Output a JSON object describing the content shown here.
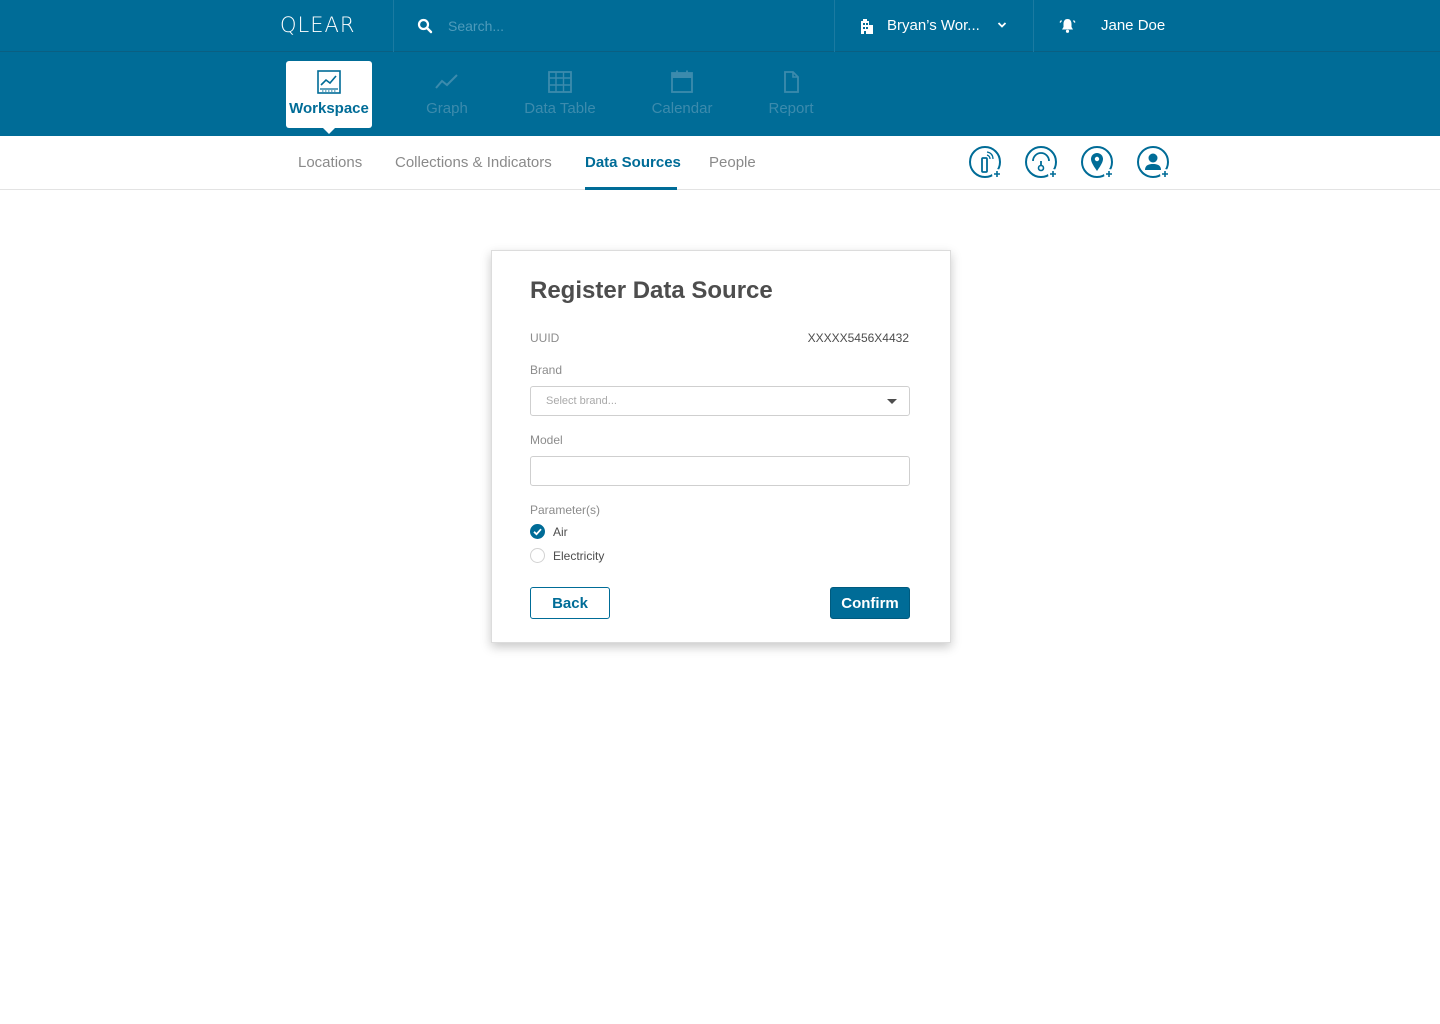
{
  "app": {
    "logo": "QLEAR"
  },
  "topbar": {
    "search_placeholder": "Search...",
    "workspace_label": "Bryan’s Wor...",
    "user_name": "Jane Doe"
  },
  "modules": [
    {
      "label": "Workspace",
      "icon": "workspace-chart-icon",
      "active": true
    },
    {
      "label": "Graph",
      "icon": "line-graph-icon",
      "active": false
    },
    {
      "label": "Data Table",
      "icon": "table-grid-icon",
      "active": false
    },
    {
      "label": "Calendar",
      "icon": "calendar-icon",
      "active": false
    },
    {
      "label": "Report",
      "icon": "document-icon",
      "active": false
    }
  ],
  "subnav": {
    "tabs": [
      {
        "label": "Locations",
        "active": false
      },
      {
        "label": "Collections & Indicators",
        "active": false
      },
      {
        "label": "Data Sources",
        "active": true
      },
      {
        "label": "People",
        "active": false
      }
    ],
    "actions": [
      {
        "icon": "add-sensor-icon"
      },
      {
        "icon": "add-gauge-icon"
      },
      {
        "icon": "add-location-icon"
      },
      {
        "icon": "add-person-icon"
      }
    ]
  },
  "form": {
    "title": "Register Data Source",
    "uuid_label": "UUID",
    "uuid_value": "XXXXX5456X4432",
    "brand_label": "Brand",
    "brand_placeholder": "Select brand...",
    "model_label": "Model",
    "model_value": "",
    "parameters_label": "Parameter(s)",
    "parameters": [
      {
        "label": "Air",
        "checked": true
      },
      {
        "label": "Electricity",
        "checked": false
      }
    ],
    "back_label": "Back",
    "confirm_label": "Confirm"
  },
  "colors": {
    "brand_blue": "#006c97",
    "muted_nav": "#3c8bad",
    "border": "#cfcfcf"
  }
}
